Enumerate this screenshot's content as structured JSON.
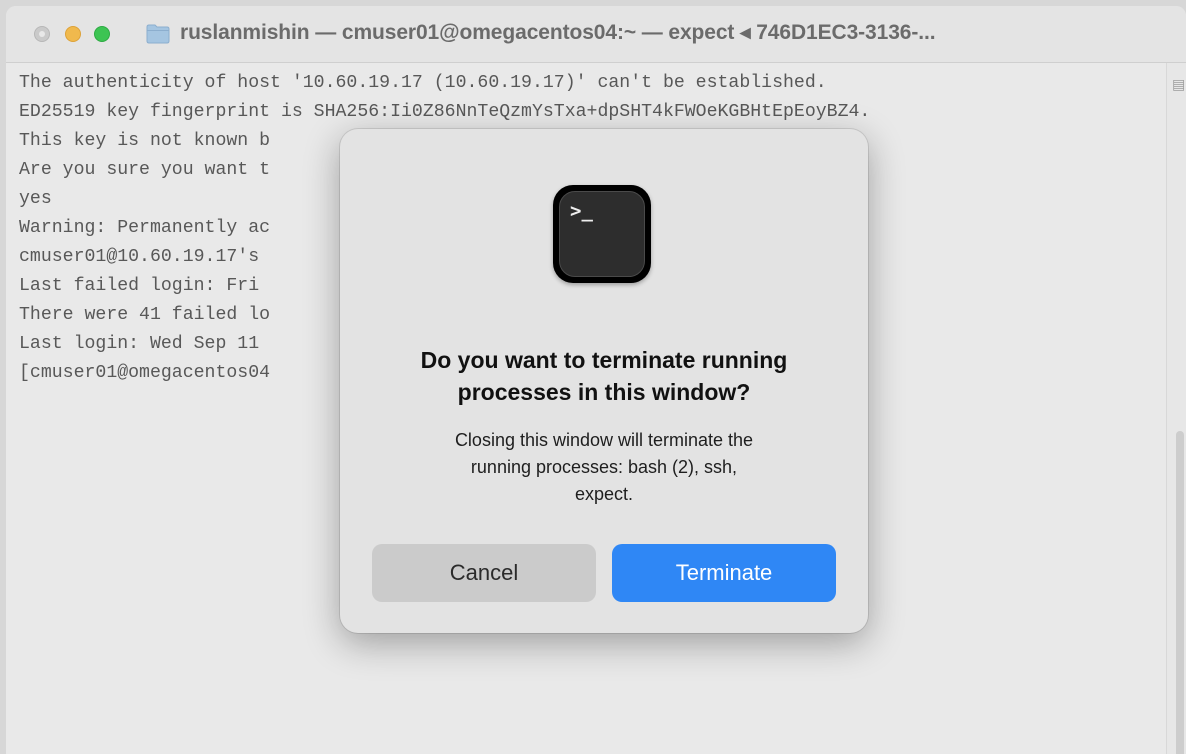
{
  "window": {
    "title": "ruslanmishin — cmuser01@omegacentos04:~ — expect ◂ 746D1EC3-3136-..."
  },
  "terminal": {
    "lines": [
      "The authenticity of host '10.60.19.17 (10.60.19.17)' can't be established.",
      "ED25519 key fingerprint is SHA256:Ii0Z86NnTeQzmYsTxa+dpSHT4kFWOeKGBHtEpEoyBZ4.",
      "This key is not known b",
      "Are you sure you want t                              rprint])? yes",
      "yes",
      "Warning: Permanently ac                              ist of known hosts.",
      "cmuser01@10.60.19.17's",
      "Last failed login: Fri                               1.65 on ssh:notty",
      "There were 41 failed lo                              l login.",
      "Last login: Wed Sep 11",
      "[cmuser01@omegacentos04"
    ]
  },
  "dialog": {
    "icon": "terminal-app-icon",
    "icon_prompt": ">_",
    "title_line1": "Do you want to terminate running",
    "title_line2": "processes in this window?",
    "message_line1": "Closing this window will terminate the",
    "message_line2": "running processes: bash (2), ssh,",
    "message_line3": "expect.",
    "cancel_label": "Cancel",
    "terminate_label": "Terminate"
  },
  "colors": {
    "accent": "#2f87f5",
    "close_light": "#cfcfcf",
    "minimize_light": "#f5bd4f",
    "maximize_light": "#3fc855"
  }
}
